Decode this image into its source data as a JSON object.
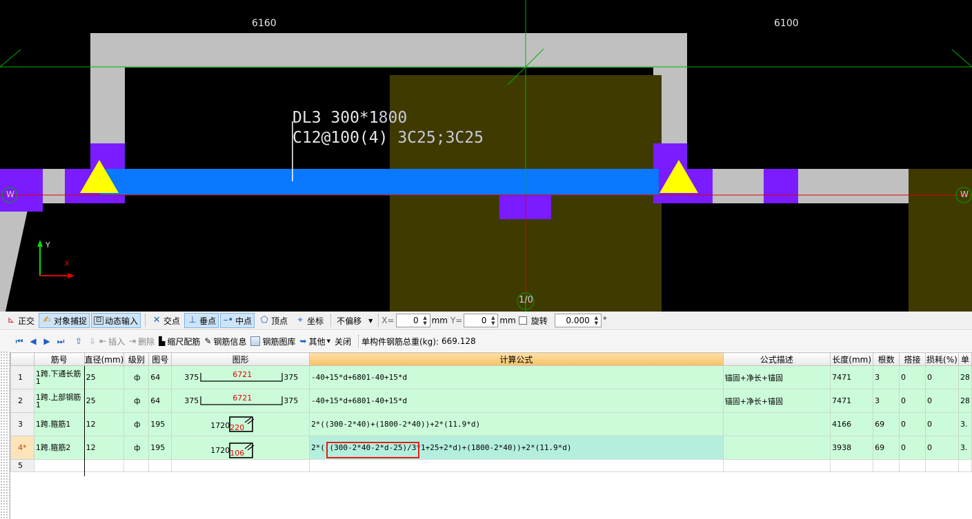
{
  "cad": {
    "dims": [
      "6160",
      "6100"
    ],
    "beam_label_line1": "DL3 300*1",
    "beam_label_line1_b": "800",
    "beam_label_line2": "C12@100(4) ",
    "beam_label_line2_b": "3C25;3C25",
    "axis_w_left": "W",
    "axis_w_right": "W",
    "axis_bottom": "1/0",
    "axis_y": "Y",
    "axis_x": "X",
    "colors": {
      "background": "#000000",
      "column": "#c0c0c0",
      "beam": "#0a78ff",
      "support": "#7a1cff",
      "wall": "#3f3b00",
      "support_marker": "#ffff00"
    }
  },
  "snap_toolbar": {
    "ortho": "正交",
    "object_snap": "对象捕捉",
    "dynamic_input": "动态输入",
    "intersection": "交点",
    "perpendicular": "垂点",
    "midpoint": "中点",
    "vertex": "顶点",
    "coordinate": "坐标",
    "offset_mode": "不偏移",
    "x_label": "X=",
    "x_value": "0",
    "y_label": "Y=",
    "y_value": "0",
    "unit": "mm",
    "rotate_label": "旋转",
    "rotate_value": "0.000",
    "degree": "°"
  },
  "rebar_toolbar": {
    "insert": "插入",
    "delete": "删除",
    "scale_rebar": "缩尺配筋",
    "rebar_info": "钢筋信息",
    "rebar_library": "钢筋图库",
    "other": "其他",
    "close": "关闭",
    "total_label": "单构件钢筋总重(kg):",
    "total_value": "669.128"
  },
  "grid": {
    "headers": [
      "筋号",
      "直径(mm)",
      "级别",
      "图号",
      "图形",
      "计算公式",
      "公式描述",
      "长度(mm)",
      "根数",
      "搭接",
      "损耗(%)",
      "单"
    ],
    "rows": [
      {
        "num": "1",
        "name": "1跨.下通长筋1",
        "dia": "25",
        "level": "ф",
        "fig": "64",
        "shape_left": "375",
        "shape_mid": "6721",
        "shape_right": "375",
        "formula": "-40+15*d+6801-40+15*d",
        "desc": "锚固+净长+锚固",
        "length": "7471",
        "count": "3",
        "lap": "0",
        "loss": "0",
        "unit": "28"
      },
      {
        "num": "2",
        "name": "1跨.上部钢筋1",
        "dia": "25",
        "level": "ф",
        "fig": "64",
        "shape_left": "375",
        "shape_mid": "6721",
        "shape_right": "375",
        "formula": "-40+15*d+6801-40+15*d",
        "desc": "锚固+净长+锚固",
        "length": "7471",
        "count": "3",
        "lap": "0",
        "loss": "0",
        "unit": "28"
      },
      {
        "num": "3",
        "name": "1跨.箍筋1",
        "dia": "12",
        "level": "ф",
        "fig": "195",
        "shape_left": "1720",
        "shape_mid": "220",
        "formula": "2*((300-2*40)+(1800-2*40))+2*(11.9*d)",
        "desc": "",
        "length": "4166",
        "count": "69",
        "lap": "0",
        "loss": "0",
        "unit": "3."
      },
      {
        "num": "4*",
        "name": "1跨.箍筋2",
        "dia": "12",
        "level": "ф",
        "fig": "195",
        "shape_left": "1720",
        "shape_mid": "106",
        "formula": "2*(((300-2*40-2*d-25)/3*1+25+2*d)+(1800-2*40))+2*(11.9*d)",
        "desc": "",
        "length": "3938",
        "count": "69",
        "lap": "0",
        "loss": "0",
        "unit": "3."
      },
      {
        "num": "5"
      }
    ]
  }
}
